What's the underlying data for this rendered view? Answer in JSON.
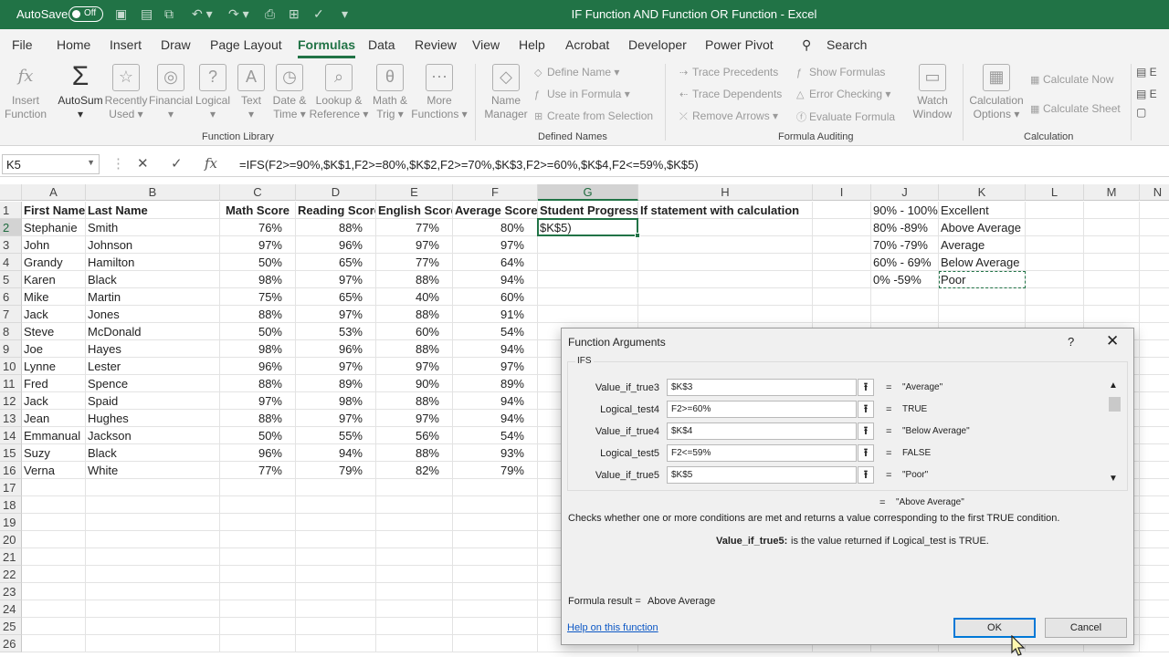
{
  "titlebar": {
    "autosave_label": "AutoSave",
    "autosave_state": "Off",
    "doc_title": "IF Function AND Function OR Function  -  Excel"
  },
  "tabs": [
    "File",
    "Home",
    "Insert",
    "Draw",
    "Page Layout",
    "Formulas",
    "Data",
    "Review",
    "View",
    "Help",
    "Acrobat",
    "Developer",
    "Power Pivot"
  ],
  "active_tab": "Formulas",
  "search_label": "Search",
  "ribbon": {
    "insert_function": [
      "Insert",
      "Function"
    ],
    "autosum": "AutoSum",
    "recently_used": [
      "Recently",
      "Used"
    ],
    "financial": "Financial",
    "logical": "Logical",
    "text": "Text",
    "date_time": [
      "Date &",
      "Time"
    ],
    "lookup": [
      "Lookup &",
      "Reference"
    ],
    "math": [
      "Math &",
      "Trig"
    ],
    "more": [
      "More",
      "Functions"
    ],
    "function_library": "Function Library",
    "name_manager": [
      "Name",
      "Manager"
    ],
    "define_name": "Define Name",
    "use_in_formula": "Use in Formula",
    "create_from_selection": "Create from Selection",
    "defined_names": "Defined Names",
    "trace_precedents": "Trace Precedents",
    "trace_dependents": "Trace Dependents",
    "remove_arrows": "Remove Arrows",
    "show_formulas": "Show Formulas",
    "error_checking": "Error Checking",
    "evaluate_formula": "Evaluate Formula",
    "watch_window": [
      "Watch",
      "Window"
    ],
    "formula_auditing": "Formula Auditing",
    "calc_options": [
      "Calculation",
      "Options"
    ],
    "calc_now": "Calculate Now",
    "calc_sheet": "Calculate Sheet",
    "calculation": "Calculation"
  },
  "formula_bar": {
    "name_box": "K5",
    "formula": "=IFS(F2>=90%,$K$1,F2>=80%,$K$2,F2>=70%,$K$3,F2>=60%,$K$4,F2<=59%,$K$5)"
  },
  "sheet": {
    "columns": [
      "A",
      "B",
      "C",
      "D",
      "E",
      "F",
      "G",
      "H",
      "I",
      "J",
      "K",
      "L",
      "M",
      "N"
    ],
    "headers": [
      "First Name",
      "Last Name",
      "Math Score",
      "Reading Score",
      "English Score",
      "Average Score",
      "Student Progress",
      "If statement with calculation"
    ],
    "rows": [
      [
        "Stephanie",
        "Smith",
        "76%",
        "88%",
        "77%",
        "80%"
      ],
      [
        "John",
        "Johnson",
        "97%",
        "96%",
        "97%",
        "97%"
      ],
      [
        "Grandy",
        "Hamilton",
        "50%",
        "65%",
        "77%",
        "64%"
      ],
      [
        "Karen",
        "Black",
        "98%",
        "97%",
        "88%",
        "94%"
      ],
      [
        "Mike",
        "Martin",
        "75%",
        "65%",
        "40%",
        "60%"
      ],
      [
        "Jack",
        "Jones",
        "88%",
        "97%",
        "88%",
        "91%"
      ],
      [
        "Steve",
        "McDonald",
        "50%",
        "53%",
        "60%",
        "54%"
      ],
      [
        "Joe",
        "Hayes",
        "98%",
        "96%",
        "88%",
        "94%"
      ],
      [
        "Lynne",
        "Lester",
        "96%",
        "97%",
        "97%",
        "97%"
      ],
      [
        "Fred",
        "Spence",
        "88%",
        "89%",
        "90%",
        "89%"
      ],
      [
        "Jack",
        "Spaid",
        "97%",
        "98%",
        "88%",
        "94%"
      ],
      [
        "Jean",
        "Hughes",
        "88%",
        "97%",
        "97%",
        "94%"
      ],
      [
        "Emmanual",
        "Jackson",
        "50%",
        "55%",
        "56%",
        "54%"
      ],
      [
        "Suzy",
        "Black",
        "96%",
        "94%",
        "88%",
        "93%"
      ],
      [
        "Verna",
        "White",
        "77%",
        "79%",
        "82%",
        "79%"
      ]
    ],
    "g2_value": "$K$5)",
    "lookup": [
      [
        "90% - 100%",
        "Excellent"
      ],
      [
        "80% -89%",
        "Above Average"
      ],
      [
        "70% -79%",
        "Average"
      ],
      [
        "60% - 69%",
        "Below Average"
      ],
      [
        "0% -59%",
        "Poor"
      ]
    ],
    "row_numbers": [
      "1",
      "2",
      "3",
      "4",
      "5",
      "6",
      "7",
      "8",
      "9",
      "10",
      "11",
      "12",
      "13",
      "14",
      "15",
      "16",
      "17",
      "18",
      "19",
      "20",
      "21",
      "22",
      "23",
      "24",
      "25",
      "26"
    ]
  },
  "dialog": {
    "title": "Function Arguments",
    "help_glyph": "?",
    "close_glyph": "✕",
    "function_name": "IFS",
    "args": [
      {
        "label": "Value_if_true3",
        "value": "$K$3",
        "result": "\"Average\""
      },
      {
        "label": "Logical_test4",
        "value": "F2>=60%",
        "result": "TRUE"
      },
      {
        "label": "Value_if_true4",
        "value": "$K$4",
        "result": "\"Below Average\""
      },
      {
        "label": "Logical_test5",
        "value": "F2<=59%",
        "result": "FALSE"
      },
      {
        "label": "Value_if_true5",
        "value": "$K$5",
        "result": "\"Poor\""
      }
    ],
    "overall_result": "\"Above Average\"",
    "description": "Checks whether one or more conditions are met and returns a value corresponding to the first TRUE condition.",
    "arg_help_name": "Value_if_true5:",
    "arg_help_text": "is the value returned if Logical_test is TRUE.",
    "formula_result_label": "Formula result =",
    "formula_result_value": "Above Average",
    "help_link": "Help on this function",
    "ok": "OK",
    "cancel": "Cancel"
  }
}
